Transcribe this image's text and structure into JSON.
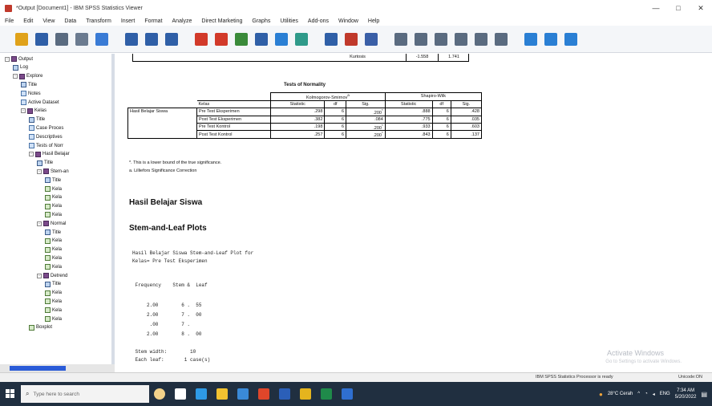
{
  "window": {
    "title": "*Output [Document1] - IBM SPSS Statistics Viewer",
    "controls": [
      "—",
      "□",
      "✕"
    ]
  },
  "menu": [
    "File",
    "Edit",
    "View",
    "Data",
    "Transform",
    "Insert",
    "Format",
    "Analyze",
    "Direct Marketing",
    "Graphs",
    "Utilities",
    "Add-ons",
    "Window",
    "Help"
  ],
  "toolbar": {
    "icons": [
      {
        "name": "open-icon",
        "color": "#e0a21a"
      },
      {
        "name": "save-icon",
        "color": "#2f5fa7"
      },
      {
        "name": "print-icon",
        "color": "#5a6b80"
      },
      {
        "name": "print-preview-icon",
        "color": "#6b7b90"
      },
      {
        "name": "export-icon",
        "color": "#3a7bd5"
      },
      {
        "name": "recall-dialog-icon",
        "color": "#2f5fa7"
      },
      {
        "name": "undo-icon",
        "color": "#2f5fa7"
      },
      {
        "name": "redo-icon",
        "color": "#2f5fa7"
      },
      {
        "name": "goto-data-icon",
        "color": "#d23a2a"
      },
      {
        "name": "goto-case-icon",
        "color": "#d23a2a"
      },
      {
        "name": "variables-icon",
        "color": "#3a8a3a"
      },
      {
        "name": "chart-icon",
        "color": "#2f5fa7"
      },
      {
        "name": "designate-window-icon",
        "color": "#2a7fd4"
      },
      {
        "name": "run-script-icon",
        "color": "#2f9a8a"
      },
      {
        "name": "pivot-icon",
        "color": "#2f5fa7"
      },
      {
        "name": "spss-icon",
        "color": "#c0392b"
      },
      {
        "name": "output-icon",
        "color": "#3a5fa7"
      },
      {
        "name": "promote-icon",
        "color": "#5a6b80"
      },
      {
        "name": "demote-icon",
        "color": "#5a6b80"
      },
      {
        "name": "expand-icon",
        "color": "#5a6b80"
      },
      {
        "name": "collapse-icon",
        "color": "#5a6b80"
      },
      {
        "name": "show-icon",
        "color": "#5a6b80"
      },
      {
        "name": "hide-icon",
        "color": "#5a6b80"
      },
      {
        "name": "insert-heading-icon",
        "color": "#2a7fd4"
      },
      {
        "name": "insert-title-icon",
        "color": "#2a7fd4"
      },
      {
        "name": "insert-text-icon",
        "color": "#2a7fd4"
      }
    ]
  },
  "nav": {
    "items": [
      {
        "label": "Output",
        "level": 0,
        "icon": "book",
        "exp": "-"
      },
      {
        "label": "Log",
        "level": 1,
        "icon": "title",
        "exp": ""
      },
      {
        "label": "Explore",
        "level": 1,
        "icon": "book",
        "exp": "-"
      },
      {
        "label": "Title",
        "level": 2,
        "icon": "title",
        "exp": ""
      },
      {
        "label": "Notes",
        "level": 2,
        "icon": "table",
        "exp": ""
      },
      {
        "label": "Active Dataset",
        "level": 2,
        "icon": "table",
        "exp": ""
      },
      {
        "label": "Kelas",
        "level": 2,
        "icon": "book",
        "exp": "-"
      },
      {
        "label": "Title",
        "level": 3,
        "icon": "title",
        "exp": ""
      },
      {
        "label": "Case Proces",
        "level": 3,
        "icon": "table",
        "exp": ""
      },
      {
        "label": "Descriptives",
        "level": 3,
        "icon": "table",
        "exp": ""
      },
      {
        "label": "Tests of Norr",
        "level": 3,
        "icon": "table",
        "exp": ""
      },
      {
        "label": "Hasil Belajar",
        "level": 3,
        "icon": "book",
        "exp": "-"
      },
      {
        "label": "Title",
        "level": 4,
        "icon": "title",
        "exp": ""
      },
      {
        "label": "Stem-an",
        "level": 4,
        "icon": "book",
        "exp": "-"
      },
      {
        "label": "Title",
        "level": 5,
        "icon": "title",
        "exp": ""
      },
      {
        "label": "Kela",
        "level": 5,
        "icon": "chart",
        "exp": ""
      },
      {
        "label": "Kela",
        "level": 5,
        "icon": "chart",
        "exp": ""
      },
      {
        "label": "Kela",
        "level": 5,
        "icon": "chart",
        "exp": ""
      },
      {
        "label": "Kela",
        "level": 5,
        "icon": "chart",
        "exp": ""
      },
      {
        "label": "Normal",
        "level": 4,
        "icon": "book",
        "exp": "-"
      },
      {
        "label": "Title",
        "level": 5,
        "icon": "title",
        "exp": ""
      },
      {
        "label": "Kela",
        "level": 5,
        "icon": "chart",
        "exp": ""
      },
      {
        "label": "Kela",
        "level": 5,
        "icon": "chart",
        "exp": ""
      },
      {
        "label": "Kela",
        "level": 5,
        "icon": "chart",
        "exp": ""
      },
      {
        "label": "Kela",
        "level": 5,
        "icon": "chart",
        "exp": ""
      },
      {
        "label": "Detrend",
        "level": 4,
        "icon": "book",
        "exp": "-"
      },
      {
        "label": "Title",
        "level": 5,
        "icon": "title",
        "exp": ""
      },
      {
        "label": "Kela",
        "level": 5,
        "icon": "chart",
        "exp": ""
      },
      {
        "label": "Kela",
        "level": 5,
        "icon": "chart",
        "exp": ""
      },
      {
        "label": "Kela",
        "level": 5,
        "icon": "chart",
        "exp": ""
      },
      {
        "label": "Kela",
        "level": 5,
        "icon": "chart",
        "exp": ""
      },
      {
        "label": "Boxplot",
        "level": 3,
        "icon": "chart",
        "exp": ""
      }
    ]
  },
  "prev_table_row": {
    "label": "Kurtosis",
    "value": "-1.558",
    "se": "1.741"
  },
  "normality": {
    "title": "Tests of Normality",
    "ks_header": "Kolmogorov-Smirnov",
    "ks_sup": "a",
    "sw_header": "Shapiro-Wilk",
    "col_kelas": "Kelas",
    "cols": [
      "Statistic",
      "df",
      "Sig.",
      "Statistic",
      "df",
      "Sig."
    ],
    "row_label": "Hasil Belajar Siswa",
    "rows": [
      {
        "kelas": "Pre Test Eksperimen",
        "vals": [
          ".298",
          "6",
          ".200",
          ".888",
          "6",
          ".428"
        ],
        "star": "*"
      },
      {
        "kelas": "Post Test Eksperimen",
        "vals": [
          ".382",
          "6",
          ".084",
          ".775",
          "6",
          ".035"
        ],
        "star": ""
      },
      {
        "kelas": "Pre Test Kontrol",
        "vals": [
          ".198",
          "6",
          ".200",
          ".933",
          "6",
          ".603"
        ],
        "star": "*"
      },
      {
        "kelas": "Post Test Kontrol",
        "vals": [
          ".257",
          "6",
          ".200",
          ".843",
          "6",
          ".137"
        ],
        "star": "*"
      }
    ],
    "footnote1": "*. This is a lower bound of the true significance.",
    "footnote2": "a. Lilliefors Significance Correction"
  },
  "headings": {
    "section": "Hasil Belajar Siswa",
    "stemleaf": "Stem-and-Leaf Plots"
  },
  "stemleaf": {
    "line1": "Hasil Belajar Siswa Stem-and-Leaf Plot for",
    "line2": "Kelas= Pre Test Eksperimen",
    "header": " Frequency    Stem &  Leaf",
    "rows": [
      "     2.00        6 .  55",
      "     2.00        7 .  00",
      "      .00        7 .",
      "     2.00        8 .  00"
    ],
    "stem_width": " Stem width:        10",
    "each_leaf": " Each leaf:       1 case(s)"
  },
  "watermark": {
    "title": "Activate Windows",
    "sub": "Go to Settings to activate Windows."
  },
  "status": {
    "processor": "IBM SPSS Statistics Processor is ready",
    "unicode": "Unicode:ON"
  },
  "taskbar": {
    "search_placeholder": "Type here to search",
    "weather": "28°C Cerah",
    "time": "7:34 AM",
    "date": "5/20/2022",
    "apps": [
      {
        "name": "task-view-icon",
        "color": "#ffffff"
      },
      {
        "name": "edge-icon",
        "color": "#2e9ae6"
      },
      {
        "name": "file-explorer-icon",
        "color": "#f2c230"
      },
      {
        "name": "store-icon",
        "color": "#3a8ad8"
      },
      {
        "name": "office-icon",
        "color": "#e0462a"
      },
      {
        "name": "word-icon",
        "color": "#2b5fb8"
      },
      {
        "name": "chrome-icon",
        "color": "#e5b41e"
      },
      {
        "name": "excel-icon",
        "color": "#1f8a4a"
      },
      {
        "name": "spss-taskbar-icon",
        "color": "#2f6fd0"
      }
    ]
  }
}
